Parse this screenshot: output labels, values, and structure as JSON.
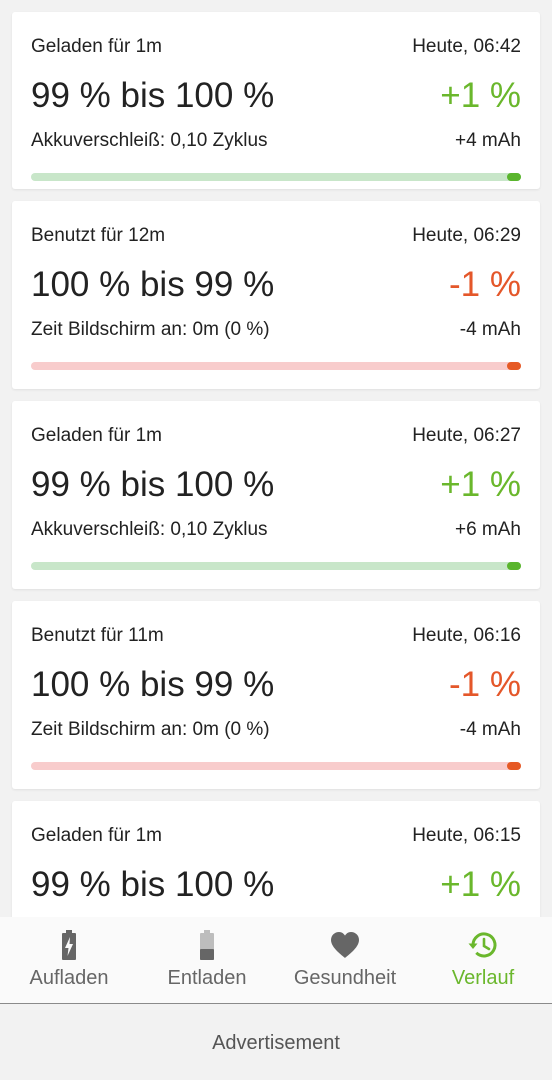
{
  "entries": [
    {
      "duration": "Geladen für 1m",
      "time": "Heute, 06:42",
      "range": "99 % bis 100 %",
      "delta": "+1 %",
      "detail": "Akkuverschleiß: 0,10 Zyklus",
      "mah": "+4 mAh",
      "type": "charge"
    },
    {
      "duration": "Benutzt für 12m",
      "time": "Heute, 06:29",
      "range": "100 % bis 99 %",
      "delta": "-1 %",
      "detail": "Zeit Bildschirm an: 0m (0 %)",
      "mah": "-4 mAh",
      "type": "discharge"
    },
    {
      "duration": "Geladen für 1m",
      "time": "Heute, 06:27",
      "range": "99 % bis 100 %",
      "delta": "+1 %",
      "detail": "Akkuverschleiß: 0,10 Zyklus",
      "mah": "+6 mAh",
      "type": "charge"
    },
    {
      "duration": "Benutzt für 11m",
      "time": "Heute, 06:16",
      "range": "100 % bis 99 %",
      "delta": "-1 %",
      "detail": "Zeit Bildschirm an: 0m (0 %)",
      "mah": "-4 mAh",
      "type": "discharge"
    },
    {
      "duration": "Geladen für 1m",
      "time": "Heute, 06:15",
      "range": "99 % bis 100 %",
      "delta": "+1 %",
      "type": "charge"
    }
  ],
  "nav": {
    "tabs": [
      {
        "label": "Aufladen",
        "icon": "battery-charging-icon"
      },
      {
        "label": "Entladen",
        "icon": "battery-low-icon"
      },
      {
        "label": "Gesundheit",
        "icon": "heart-icon"
      },
      {
        "label": "Verlauf",
        "icon": "history-icon",
        "active": true
      }
    ]
  },
  "ad": {
    "label": "Advertisement"
  },
  "colors": {
    "charge": "#6ab72c",
    "discharge": "#e4572a",
    "charge_bar": "#c8e6c9",
    "discharge_bar": "#f8cccc"
  }
}
